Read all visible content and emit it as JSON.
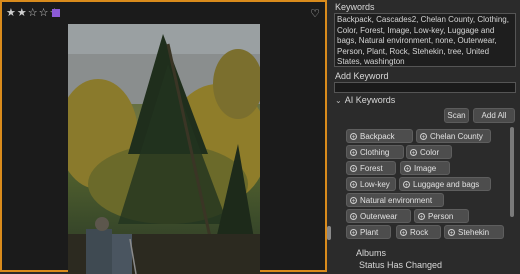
{
  "viewer": {
    "rating": {
      "filled": 2,
      "total": 5
    },
    "color_label": "#8c5bd6",
    "accent": "#d98b1c"
  },
  "panel": {
    "keywords_title": "Keywords",
    "keywords_text": "Backpack, Cascades2, Chelan County, Clothing, Color, Forest, Image, Low-key, Luggage and bags, Natural environment, none, Outerwear, Person, Plant, Rock, Stehekin, tree, United States, washington",
    "add_keyword_label": "Add Keyword",
    "add_keyword_value": "",
    "ai_keywords_title": "AI Keywords",
    "scan_label": "Scan",
    "add_all_label": "Add All",
    "ai_chips": [
      "Backpack",
      "Chelan County",
      "Clothing",
      "Color",
      "Forest",
      "Image",
      "Low-key",
      "Luggage and bags",
      "Natural environment",
      "Outerwear",
      "Person",
      "Plant",
      "Rock",
      "Stehekin"
    ],
    "albums_label": "Albums",
    "status_label": "Status Has Changed"
  }
}
